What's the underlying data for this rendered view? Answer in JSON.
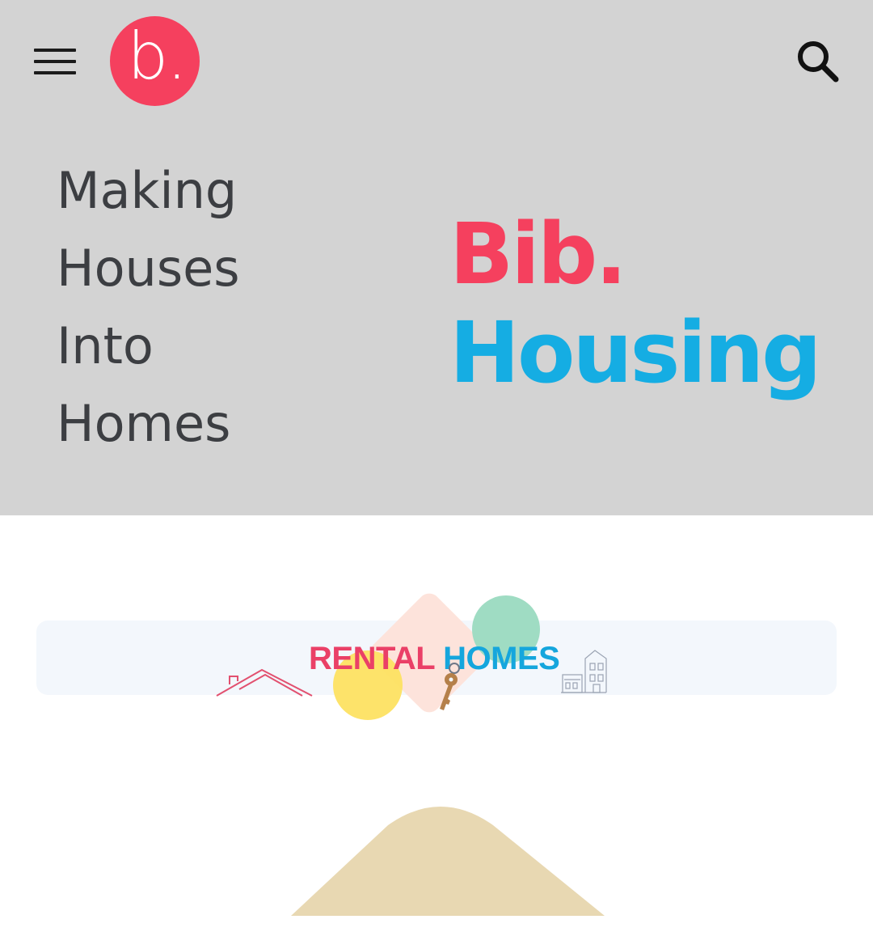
{
  "header": {
    "menu_icon": "hamburger-menu-icon",
    "logo_text": "b.",
    "search_icon": "search-icon"
  },
  "hero": {
    "tagline": [
      "Making",
      "Houses",
      "Into",
      "Homes"
    ],
    "brand_line1": "Bib.",
    "brand_line2": "Housing"
  },
  "banner": {
    "word1": "RENTAL",
    "word2": "HOMES",
    "icons": [
      "roof-outline-icon",
      "key-icon",
      "building-sketch-icon"
    ]
  },
  "colors": {
    "hero_bg": "#d3d3d3",
    "brand_pink": "#f5405e",
    "brand_blue": "#15ade3",
    "tagline_text": "#3c3e42",
    "banner_bg": "#f3f7fc",
    "hill": "#e8d8b2"
  }
}
